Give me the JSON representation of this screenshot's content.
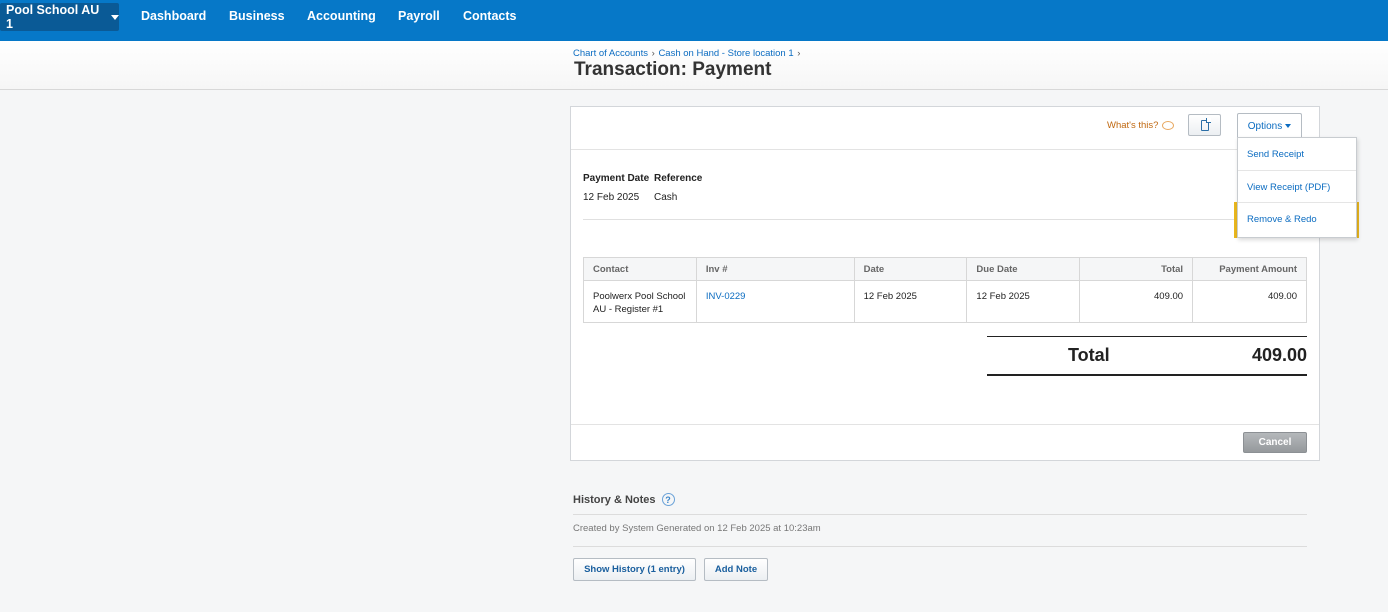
{
  "nav": {
    "org": "Pool School AU 1",
    "items": [
      "Dashboard",
      "Business",
      "Accounting",
      "Payroll",
      "Contacts"
    ]
  },
  "breadcrumb": [
    "Chart of Accounts",
    "Cash on Hand - Store location 1"
  ],
  "breadcrumb_sep": "›",
  "page_title": "Transaction: Payment",
  "toolbar": {
    "whats_this": "What's this?",
    "options_label": "Options"
  },
  "menu": {
    "items": [
      "Send Receipt",
      "View Receipt (PDF)",
      "Remove & Redo"
    ],
    "highlighted": "Remove & Redo"
  },
  "details": {
    "payment_date_label": "Payment Date",
    "payment_date": "12 Feb 2025",
    "reference_label": "Reference",
    "reference": "Cash"
  },
  "table": {
    "headers": [
      "Contact",
      "Inv #",
      "Date",
      "Due Date",
      "Total",
      "Payment Amount"
    ],
    "rows": [
      {
        "contact": "Poolwerx Pool School AU - Register #1",
        "inv": "INV-0229",
        "date": "12 Feb 2025",
        "due_date": "12 Feb 2025",
        "total": "409.00",
        "payment_amount": "409.00"
      }
    ]
  },
  "total": {
    "label": "Total",
    "value": "409.00"
  },
  "cancel_label": "Cancel",
  "history": {
    "title": "History & Notes",
    "help": "?",
    "entry": "Created by System Generated on 12 Feb 2025 at 10:23am",
    "show_history": "Show History (1 entry)",
    "add_note": "Add Note"
  },
  "colors": {
    "nav_bg": "#0678c8",
    "link": "#0b6cc1",
    "highlight_border": "#eab71e"
  }
}
